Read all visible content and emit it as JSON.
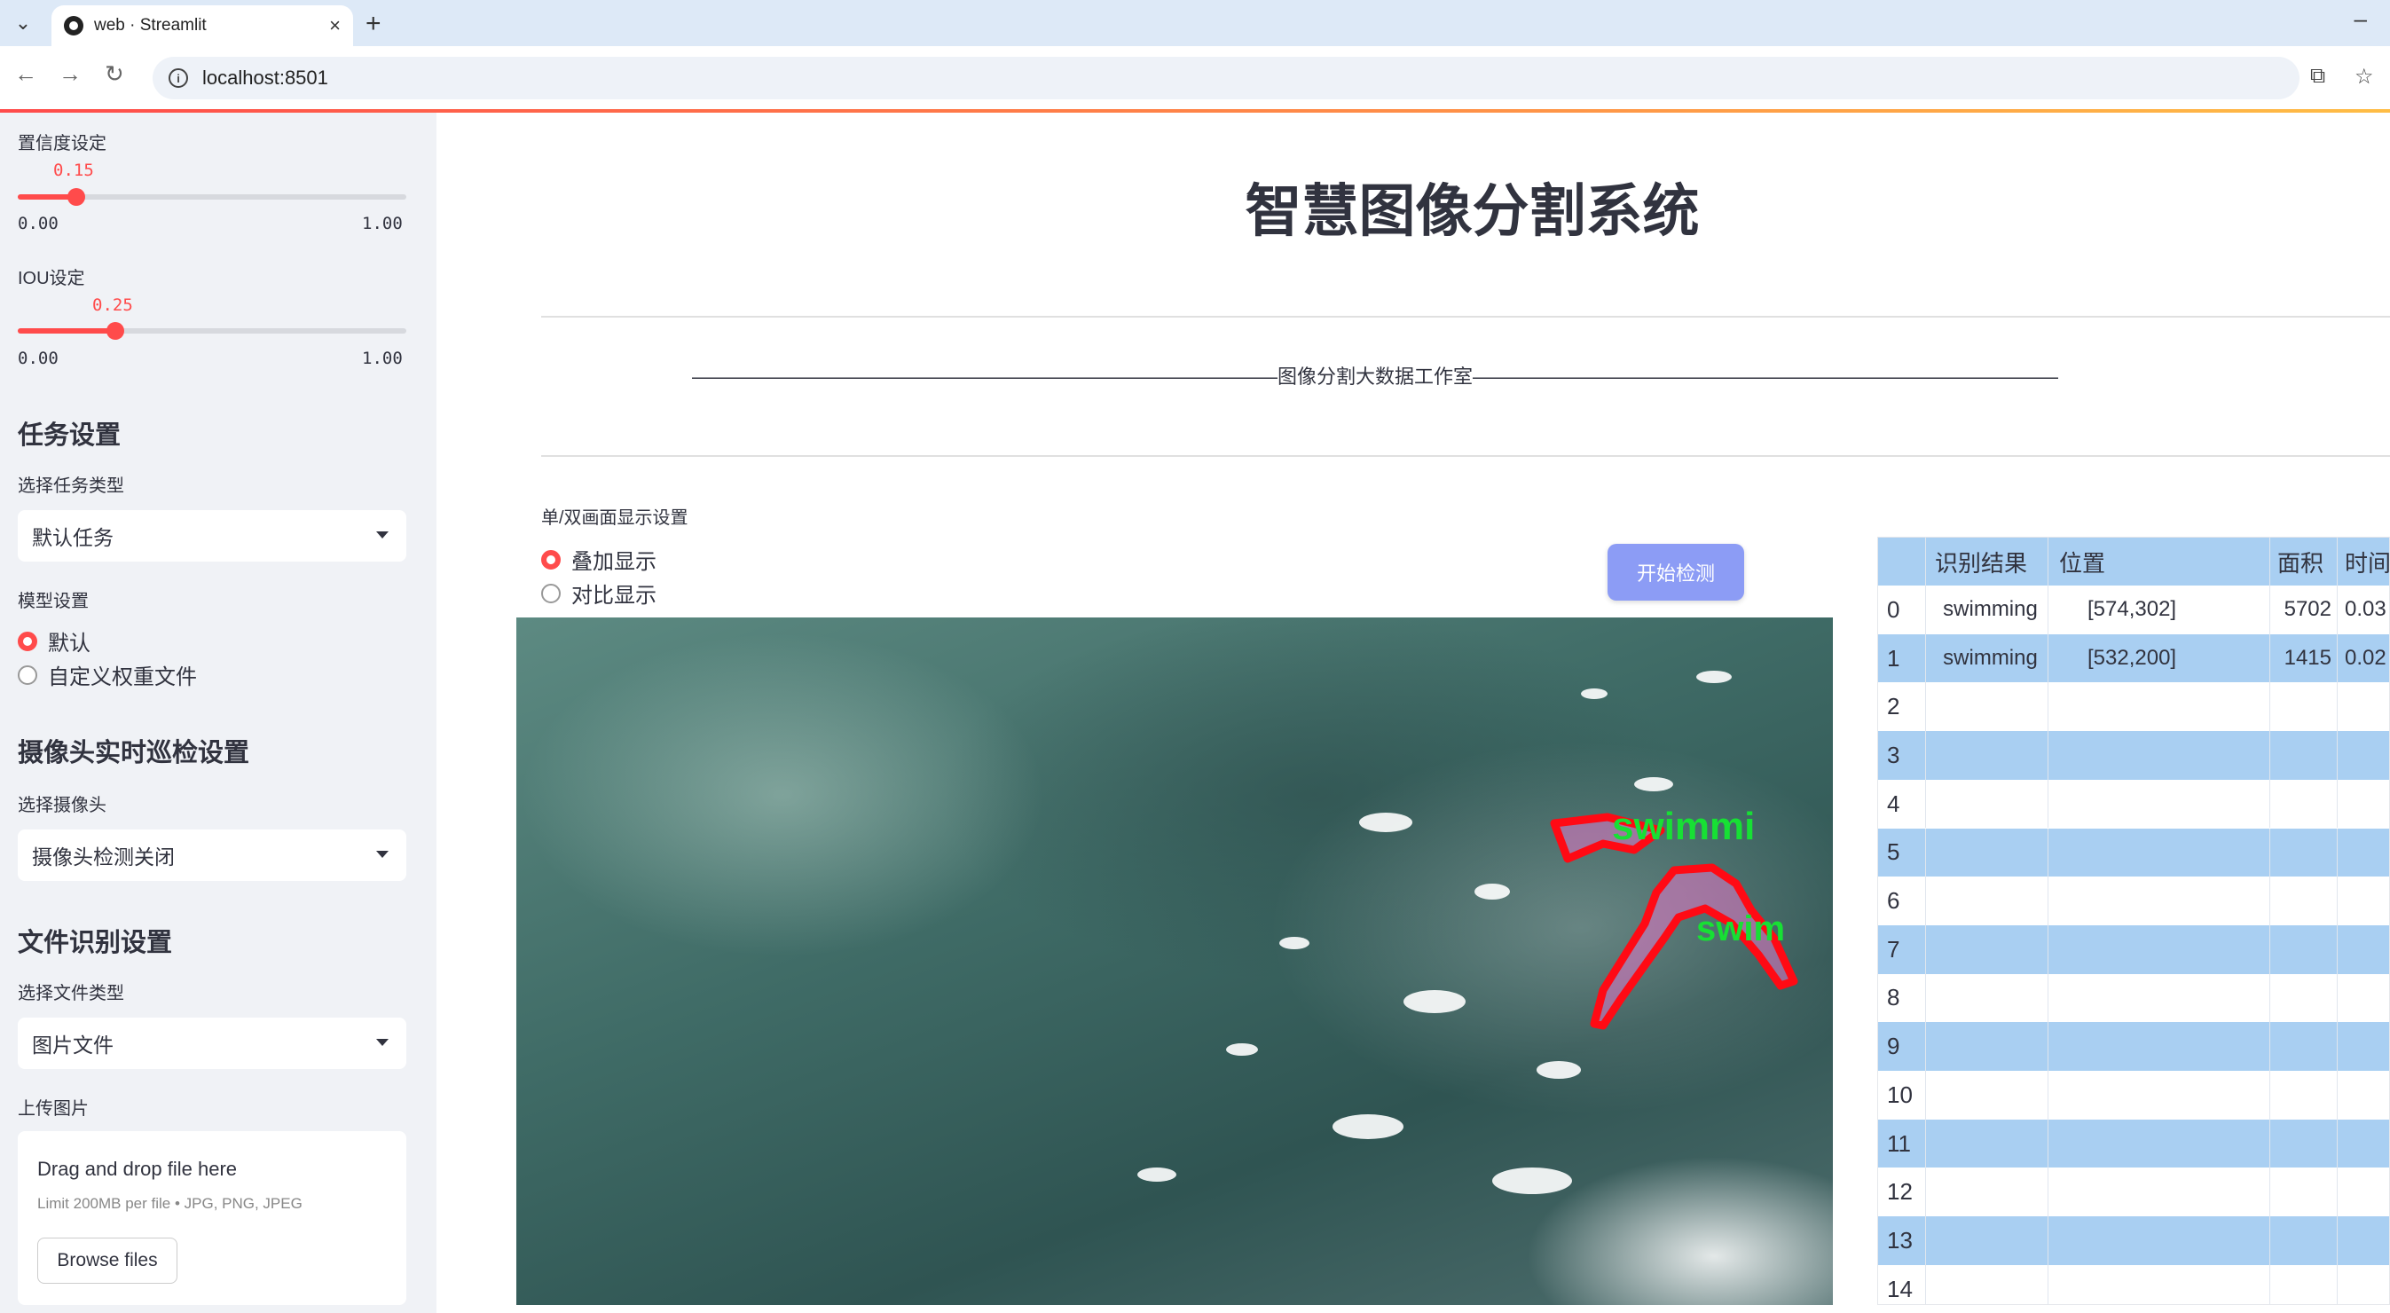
{
  "browser": {
    "tab_title": "web · Streamlit",
    "url": "localhost:8501"
  },
  "sidebar": {
    "conf_label": "置信度设定",
    "conf": {
      "value": "0.15",
      "min": "0.00",
      "max": "1.00",
      "fraction": 0.15
    },
    "iou_label": "IOU设定",
    "iou": {
      "value": "0.25",
      "min": "0.00",
      "max": "1.00",
      "fraction": 0.25
    },
    "task_header": "任务设置",
    "task_type_label": "选择任务类型",
    "task_type_value": "默认任务",
    "model_label": "模型设置",
    "model_options": [
      "默认",
      "自定义权重文件"
    ],
    "model_selected": 0,
    "camera_header": "摄像头实时巡检设置",
    "camera_label": "选择摄像头",
    "camera_value": "摄像头检测关闭",
    "file_header": "文件识别设置",
    "file_type_label": "选择文件类型",
    "file_type_value": "图片文件",
    "upload_label": "上传图片",
    "upload_title": "Drag and drop file here",
    "upload_sub": "Limit 200MB per file • JPG, PNG, JPEG",
    "upload_button": "Browse files"
  },
  "main": {
    "title": "智慧图像分割系统",
    "divider": "——————————————————————————————图像分割大数据工作室——————————————————————————————",
    "display_label": "单/双画面显示设置",
    "display_options": [
      "叠加显示",
      "对比显示"
    ],
    "display_selected": 0,
    "start_button": "开始检测",
    "detections": [
      {
        "label": "swimmi",
        "score": ""
      },
      {
        "label": "swim",
        "score": ""
      }
    ]
  },
  "table": {
    "columns": [
      "",
      "识别结果",
      "位置",
      "面积",
      "时间"
    ],
    "rows": [
      {
        "idx": "0",
        "result": "swimming",
        "pos": "[574,302]",
        "area": "5702",
        "time": "0.03"
      },
      {
        "idx": "1",
        "result": "swimming",
        "pos": "[532,200]",
        "area": "1415",
        "time": "0.02"
      },
      {
        "idx": "2",
        "result": "",
        "pos": "",
        "area": "",
        "time": ""
      },
      {
        "idx": "3",
        "result": "",
        "pos": "",
        "area": "",
        "time": ""
      },
      {
        "idx": "4",
        "result": "",
        "pos": "",
        "area": "",
        "time": ""
      },
      {
        "idx": "5",
        "result": "",
        "pos": "",
        "area": "",
        "time": ""
      },
      {
        "idx": "6",
        "result": "",
        "pos": "",
        "area": "",
        "time": ""
      },
      {
        "idx": "7",
        "result": "",
        "pos": "",
        "area": "",
        "time": ""
      },
      {
        "idx": "8",
        "result": "",
        "pos": "",
        "area": "",
        "time": ""
      },
      {
        "idx": "9",
        "result": "",
        "pos": "",
        "area": "",
        "time": ""
      },
      {
        "idx": "10",
        "result": "",
        "pos": "",
        "area": "",
        "time": ""
      },
      {
        "idx": "11",
        "result": "",
        "pos": "",
        "area": "",
        "time": ""
      },
      {
        "idx": "12",
        "result": "",
        "pos": "",
        "area": "",
        "time": ""
      },
      {
        "idx": "13",
        "result": "",
        "pos": "",
        "area": "",
        "time": ""
      },
      {
        "idx": "14",
        "result": "",
        "pos": "",
        "area": "",
        "time": ""
      }
    ]
  },
  "colors": {
    "accent": "#ff4b4b",
    "button": "#8c9cf5",
    "table_stripe": "#a9cff2",
    "sidebar_bg": "#f0f2f6"
  }
}
